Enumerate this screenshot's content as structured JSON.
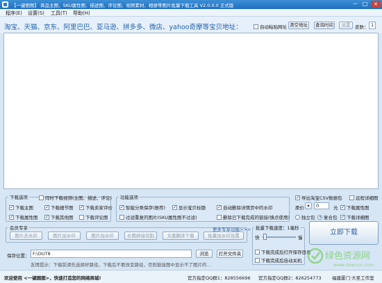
{
  "window": {
    "title": "【一键图图】 商品主图、SKU属性图、描述图、评论图、视频素材、相册等图片批量下载工具 V2.0.0.0 正式版",
    "minimize": "－",
    "restore": "□",
    "close": "×"
  },
  "menu": [
    "程序(E)",
    "设置(S)",
    "工具(T)",
    "帮助(H)"
  ],
  "linkbar": {
    "slogan": "淘宝、天猫、京东、阿里巴巴、亚马逊、拼多多、微店、yahoo奇摩等宝贝地址：",
    "auto_paste": "自动粘贴网址",
    "clear_button": "清空地址",
    "dedupe_button": "查询时间",
    "reset_button": "设置",
    "skin_label": "皮肤：",
    "skin_value": "1"
  },
  "download_options": {
    "title": "下载选项",
    "top_check": "同时下载视频(主图、描述、评论)",
    "items": [
      {
        "label": "下载主图",
        "checked": true
      },
      {
        "label": "下载细节图",
        "checked": true
      },
      {
        "label": "下载卖家评价",
        "checked": true
      },
      {
        "label": "下载SKU图",
        "checked": true
      },
      {
        "label": "下载其他图",
        "checked": true
      },
      {
        "label": "下载SKU属性",
        "checked": false
      },
      {
        "label": "下载属性图",
        "checked": true
      },
      {
        "label": "下载其他图",
        "checked": true
      },
      {
        "label": "下载评论图",
        "checked": false
      }
    ]
  },
  "feature_options": {
    "title": "功能选项",
    "items": [
      {
        "label": "智能分类保存(推荐)",
        "checked": true
      },
      {
        "label": "显示宝贝标题",
        "checked": true
      },
      {
        "label": "自动删除详情页中的水印",
        "checked": true
      },
      {
        "label": "过滤重复的图片(SKU属性图不过滤)",
        "checked": false
      },
      {
        "label": "删除已下载完成的链接(慎点使用)",
        "checked": false
      }
    ]
  },
  "right_options": {
    "export_csv": "导出淘宝CSV数据包",
    "export_csv_checked": true,
    "remote_label": "远程详细图",
    "original_label": "原价",
    "original_value": "0",
    "yuan": "元",
    "download_attr": "下载属性图",
    "download_attr_checked": true,
    "standalone": "独立包",
    "together": "复合包",
    "download_detail": "下载详细图",
    "download_detail_checked": true
  },
  "member": {
    "title": "会员专享",
    "more_link": "更多专享功能>>>",
    "buttons": [
      "图片去水印",
      "图片加水印",
      "图片加水印",
      "长图拼接切割",
      "文案翻译下载",
      "批量加水印设置"
    ]
  },
  "speed": {
    "title": "批量下载速度：1毫秒",
    "fast": "快",
    "slow": "慢",
    "open_after": "下载完成后打开保存目录",
    "shutdown_after": "下载完成后自动关机"
  },
  "save": {
    "label": "保存位置：",
    "path": "F:\\OUT8",
    "browse_button": "浏览",
    "open_folder_button": "打开文件夹",
    "tip": "友情提示：下载前请先选择好路径，下载后不要改变路径，否则链接图中显示不了图片的…"
  },
  "start_button": "立即下载",
  "status": {
    "welcome": "欢迎使用 <一键图图>，快速打造您的网络商城!",
    "qq1": "官方指定QQ群1：828556696",
    "qq2": "官方指定QQ群2：826254773",
    "vendor": "福建厦门·大圣工作室"
  },
  "watermark": {
    "text1": "绿色资源网",
    "text2": "www.downcc.com"
  }
}
